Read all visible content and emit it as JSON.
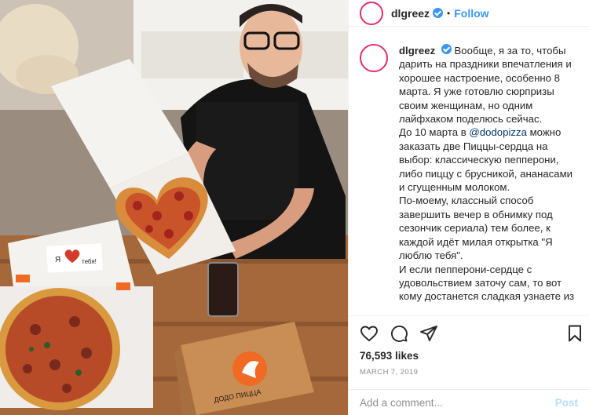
{
  "post": {
    "username": "dlgreez",
    "separator": "•",
    "follow_label": "Follow"
  },
  "caption": {
    "username": "dlgreez",
    "para1": "Вообще, я за то, чтобы дарить на праздники впечатления и хорошее настроение, особенно 8 марта. Я уже готовлю сюрпризы своим женщинам, но одним лайфхаком поделюсь сейчас.",
    "para2_before": "До 10 марта в ",
    "mention": "@dodopizza",
    "para2_after": " можно заказать две Пиццы-сердца на выбор: классическую пепперони, либо пиццу с брусникой, ананасами и сгущенным молоком.",
    "para3": "По-моему, классный способ завершить вечер в обнимку под сезончик сериала) тем более, к каждой идёт милая открытка \"Я люблю тебя\".",
    "para4": "И если пепперони-сердце с удовольствием заточу сам, то вот кому достанется сладкая узнаете из"
  },
  "likes": "76,593 likes",
  "date": "MARCH 7, 2019",
  "comment_box": {
    "placeholder": "Add a comment...",
    "post_label": "Post"
  },
  "photo": {
    "card_text_left": "Я",
    "card_text_right": "тебя!",
    "box_brand": "ДОДО ПИЦЦА"
  },
  "icons": {
    "like": "heart-icon",
    "comment": "comment-icon",
    "share": "paper-plane-icon",
    "save": "bookmark-icon"
  },
  "colors": {
    "link": "#3897f0",
    "mention": "#00376b",
    "muted": "#8e8e8e",
    "brand_orange": "#f06a24"
  }
}
